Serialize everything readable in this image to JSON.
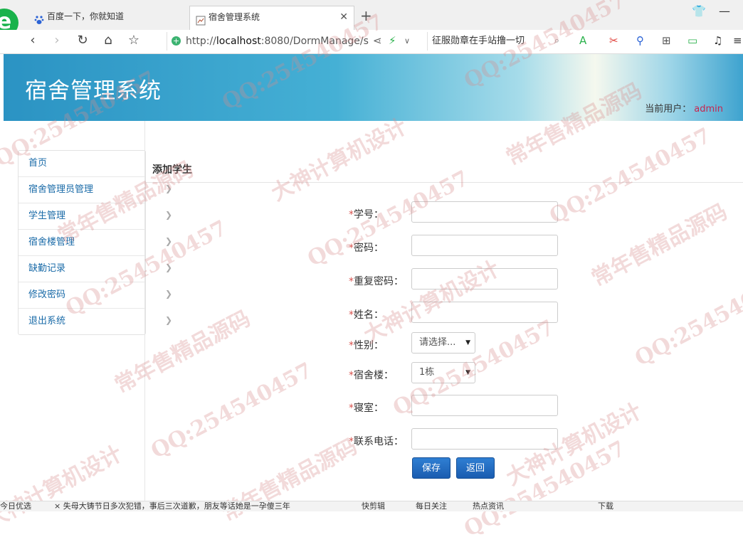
{
  "browser": {
    "tabs": [
      {
        "title": "百度一下，你就知道"
      },
      {
        "title": "宿舍管理系统"
      }
    ],
    "address": {
      "scheme": "http://",
      "host": "localhost",
      "rest": ":8080/DormManage/s"
    },
    "search_text": "征服勋章在手站撸一切",
    "status_items": [
      "今日优选",
      "× 失母大铸节日多次犯错，事后三次道歉，朋友等话她是一孕傻三年",
      "快剪辑",
      "每日关注",
      "热点资讯",
      "下载"
    ]
  },
  "header": {
    "title": "宿舍管理系统",
    "current_user_label": "当前用户：",
    "current_user": "admin"
  },
  "sidebar": {
    "items": [
      {
        "label": "首页"
      },
      {
        "label": "宿舍管理员管理"
      },
      {
        "label": "学生管理"
      },
      {
        "label": "宿舍楼管理"
      },
      {
        "label": "缺勤记录"
      },
      {
        "label": "修改密码"
      },
      {
        "label": "退出系统"
      }
    ]
  },
  "main": {
    "title": "添加学生",
    "fields": [
      {
        "label": "学号："
      },
      {
        "label": "密码："
      },
      {
        "label": "重复密码："
      },
      {
        "label": "姓名："
      },
      {
        "label": "性别：",
        "value": "请选择..."
      },
      {
        "label": "宿舍楼：",
        "value": "1栋"
      },
      {
        "label": "寝室："
      },
      {
        "label": "联系电话："
      }
    ],
    "required_mark": "*",
    "save_label": "保存",
    "back_label": "返回"
  },
  "watermarks": [
    "QQ:254540457",
    "常年售精品源码",
    "大神计算机设计"
  ],
  "colors": {
    "header_blue": "#2b93c3",
    "link": "#1a6ba8",
    "required": "#d9534f",
    "button": "#1a5cb0",
    "user": "#c7254e"
  }
}
